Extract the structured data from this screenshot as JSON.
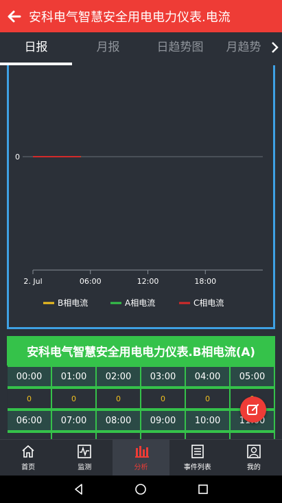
{
  "header": {
    "title": "安科电气智慧安全用电电力仪表.电流"
  },
  "tabs": [
    {
      "label": "日报",
      "active": true
    },
    {
      "label": "月报",
      "active": false
    },
    {
      "label": "日趋势图",
      "active": false
    },
    {
      "label": "月趋势",
      "active": false
    }
  ],
  "chart_data": {
    "type": "line",
    "x_tick_labels": [
      "2. Jul",
      "06:00",
      "12:00",
      "18:00"
    ],
    "x_ticks_hours": [
      0,
      6,
      12,
      18
    ],
    "xlim_hours": [
      0,
      24
    ],
    "y_tick_labels": [
      "0"
    ],
    "series": [
      {
        "name": "B相电流",
        "color": "#f0c020",
        "x_hours": [
          0,
          5
        ],
        "values": [
          0,
          0
        ]
      },
      {
        "name": "A相电流",
        "color": "#35c24a",
        "x_hours": [
          0,
          5
        ],
        "values": [
          0,
          0
        ]
      },
      {
        "name": "C相电流",
        "color": "#d42a2a",
        "x_hours": [
          0,
          5
        ],
        "values": [
          0,
          0
        ]
      }
    ],
    "legend_position": "bottom"
  },
  "report": {
    "title": "安科电气智慧安全用电电力仪表.B相电流(A)",
    "rows": [
      {
        "times": [
          "00:00",
          "01:00",
          "02:00",
          "03:00",
          "04:00",
          "05:00"
        ],
        "values": [
          "0",
          "0",
          "0",
          "0",
          "0",
          "0"
        ]
      },
      {
        "times": [
          "06:00",
          "07:00",
          "08:00",
          "09:00",
          "10:00",
          "11:00"
        ],
        "values": [
          "",
          "",
          "",
          "",
          "",
          ""
        ]
      }
    ]
  },
  "nav": [
    {
      "label": "首页",
      "icon": "home-icon",
      "active": false
    },
    {
      "label": "监测",
      "icon": "monitor-icon",
      "active": false
    },
    {
      "label": "分析",
      "icon": "analysis-icon",
      "active": true
    },
    {
      "label": "事件列表",
      "icon": "event-list-icon",
      "active": false
    },
    {
      "label": "我的",
      "icon": "profile-icon",
      "active": false
    }
  ],
  "colors": {
    "accent": "#ee3c36",
    "green": "#35c24a",
    "chart_border": "#3ea1e4"
  }
}
